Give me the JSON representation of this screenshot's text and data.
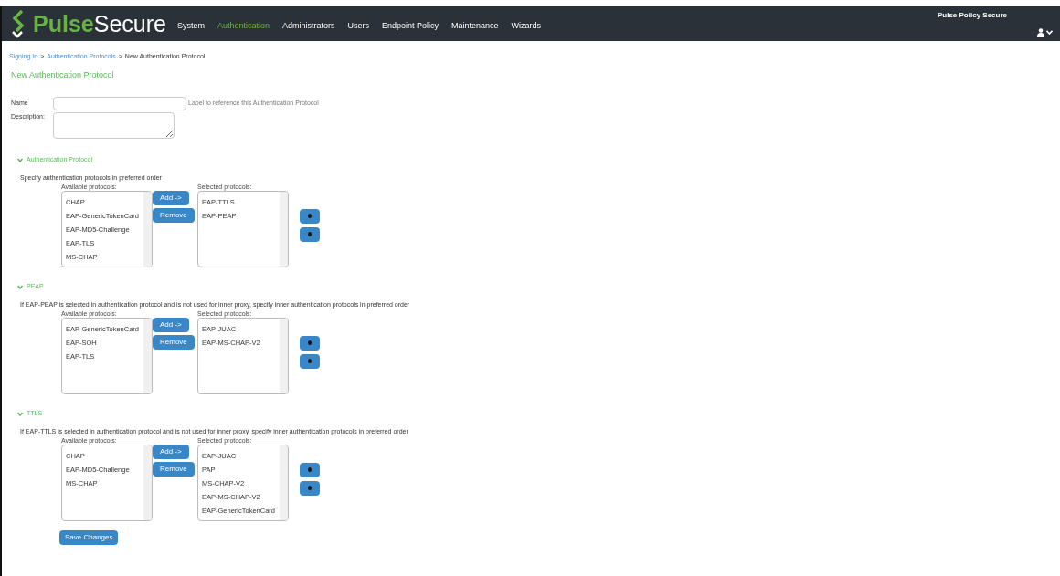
{
  "header": {
    "logo": {
      "part1": "Pulse",
      "part2": "Secure"
    },
    "nav": [
      {
        "label": "System",
        "selected": false
      },
      {
        "label": "Authentication",
        "selected": true
      },
      {
        "label": "Administrators",
        "selected": false
      },
      {
        "label": "Users",
        "selected": false
      },
      {
        "label": "Endpoint Policy",
        "selected": false
      },
      {
        "label": "Maintenance",
        "selected": false
      },
      {
        "label": "Wizards",
        "selected": false
      }
    ],
    "product": "Pulse Policy Secure"
  },
  "breadcrumb": [
    {
      "label": "Signing In",
      "link": true
    },
    {
      "label": ">",
      "link": false
    },
    {
      "label": "Authentication Protocols",
      "link": true
    },
    {
      "label": ">",
      "link": false
    },
    {
      "label": "New Authentication Protocol",
      "link": false
    }
  ],
  "page_title": "New Authentication Protocol",
  "form": {
    "name": {
      "label": "Name",
      "hint": "Label to reference this Authentication Protocol"
    },
    "description": {
      "label": "Description:"
    }
  },
  "sections": [
    {
      "title": "Authentication Protocol",
      "expanded": true,
      "instruction": "Specify authentication protocols in preferred order",
      "available_label": "Available protocols:",
      "selected_label": "Selected protocols:",
      "available": [
        "CHAP",
        "EAP-GenericTokenCard",
        "EAP-MD5-Challenge",
        "EAP-TLS",
        "MS-CHAP"
      ],
      "selected": [
        "EAP-TTLS",
        "EAP-PEAP"
      ],
      "add": "Add ->",
      "remove": "Remove"
    },
    {
      "title": "PEAP",
      "expanded": true,
      "instruction": "If EAP-PEAP is selected in authentication protocol and is not used for inner proxy, specify inner authentication protocols in preferred order",
      "available_label": "Available protocols:",
      "selected_label": "Selected protocols:",
      "available": [
        "EAP-GenericTokenCard",
        "EAP-SOH",
        "EAP-TLS"
      ],
      "selected": [
        "EAP-JUAC",
        "EAP-MS-CHAP-V2"
      ],
      "add": "Add ->",
      "remove": "Remove"
    },
    {
      "title": "TTLS",
      "expanded": true,
      "instruction": "If EAP-TTLS is selected in authentication protocol and is not used for inner proxy, specify inner authentication protocols in preferred order",
      "available_label": "Available protocols:",
      "selected_label": "Selected protocols:",
      "available": [
        "CHAP",
        "EAP-MD5-Challenge",
        "MS-CHAP"
      ],
      "selected": [
        "EAP-JUAC",
        "PAP",
        "MS-CHAP-V2",
        "EAP-MS-CHAP-V2",
        "EAP-GenericTokenCard"
      ],
      "add": "Add ->",
      "remove": "Remove"
    }
  ],
  "save_button": "Save Changes"
}
